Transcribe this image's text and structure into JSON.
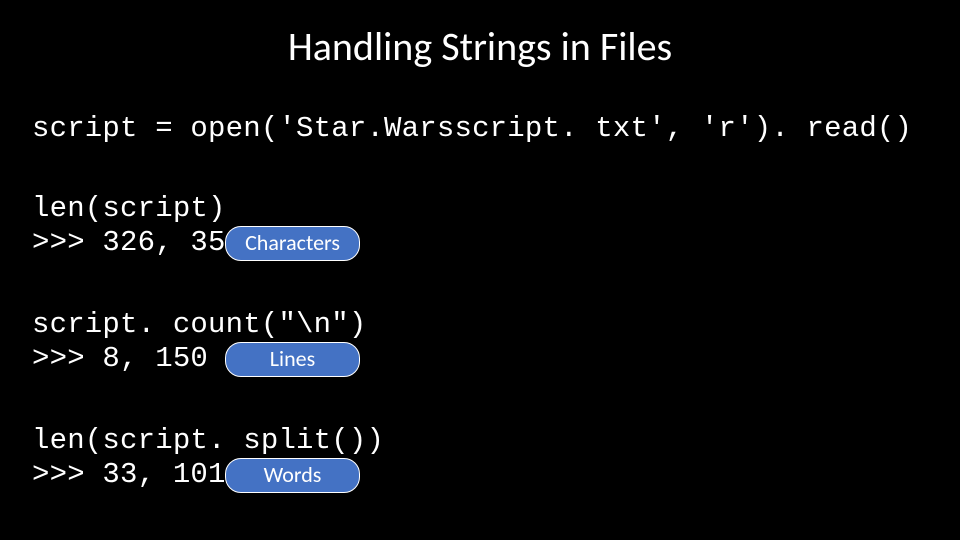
{
  "title": "Handling Strings in Files",
  "code": {
    "open_line": "script = open('Star.Warsscript. txt', 'r'). read()",
    "len_call": "len(script)",
    "len_output": ">>> 326, 359",
    "count_call": "script. count(\"\\n\")",
    "count_output": ">>> 8, 150",
    "split_call": "len(script. split())",
    "split_output": ">>> 33, 101"
  },
  "badges": {
    "characters": "Characters",
    "lines": "Lines",
    "words": "Words"
  }
}
